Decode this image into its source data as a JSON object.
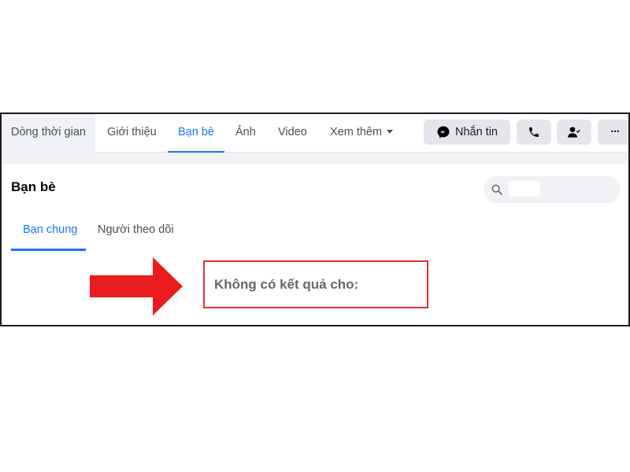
{
  "profile_nav": {
    "tabs": [
      {
        "label": "Dòng thời gian"
      },
      {
        "label": "Giới thiệu"
      },
      {
        "label": "Bạn bè"
      },
      {
        "label": "Ảnh"
      },
      {
        "label": "Video"
      },
      {
        "label": "Xem thêm"
      }
    ],
    "active_tab": "Bạn bè",
    "message_button_label": "Nhắn tin",
    "more_button_label": "···"
  },
  "friends_section": {
    "title": "Bạn bè",
    "search": {
      "value": "",
      "placeholder": ""
    },
    "subtabs": [
      {
        "label": "Bạn chung"
      },
      {
        "label": "Người theo dõi"
      }
    ],
    "active_subtab": "Bạn chung",
    "empty_message": "Không có kết quả cho:"
  },
  "colors": {
    "accent": "#1877f2",
    "annotation_red": "#e03131",
    "button_bg": "#e4e6eb"
  }
}
